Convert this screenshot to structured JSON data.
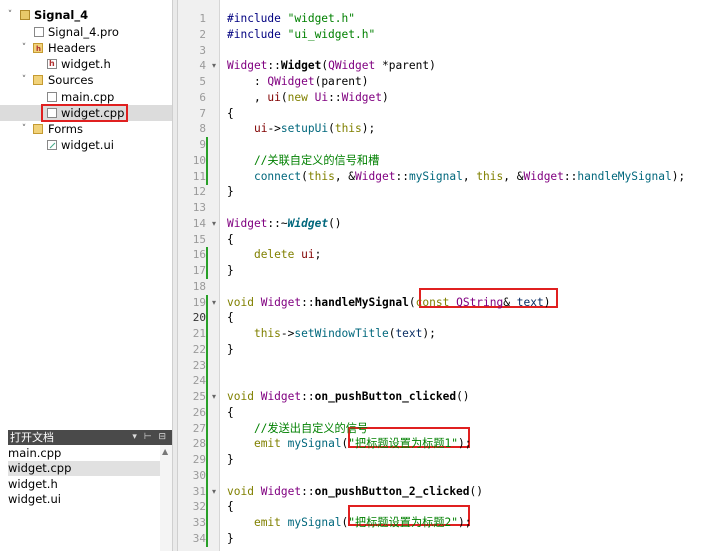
{
  "project_tree": {
    "project": "Signal_4",
    "pro_file": "Signal_4.pro",
    "headers_label": "Headers",
    "header_file": "widget.h",
    "sources_label": "Sources",
    "source_files": [
      "main.cpp",
      "widget.cpp"
    ],
    "forms_label": "Forms",
    "form_file": "widget.ui",
    "selected": "widget.cpp"
  },
  "open_documents": {
    "title": "打开文档",
    "files": [
      "main.cpp",
      "widget.cpp",
      "widget.h",
      "widget.ui"
    ],
    "selected": "widget.cpp"
  },
  "editor": {
    "current_line": 20,
    "lines": [
      {
        "n": "1",
        "t": [
          [
            "#include ",
            "pp"
          ],
          [
            "\"widget.h\"",
            "str"
          ]
        ]
      },
      {
        "n": "2",
        "t": [
          [
            "#include ",
            "pp"
          ],
          [
            "\"ui_widget.h\"",
            "str"
          ]
        ]
      },
      {
        "n": "3",
        "t": []
      },
      {
        "n": "4",
        "t": [
          [
            "Widget",
            "cls"
          ],
          [
            "::",
            "x"
          ],
          [
            "Widget",
            "def"
          ],
          [
            "(",
            "x"
          ],
          [
            "QWidget",
            "cls"
          ],
          [
            " *parent)",
            "x"
          ]
        ]
      },
      {
        "n": "5",
        "t": [
          [
            "    : ",
            "x"
          ],
          [
            "QWidget",
            "cls"
          ],
          [
            "(parent)",
            "x"
          ]
        ]
      },
      {
        "n": "6",
        "t": [
          [
            "    , ",
            "x"
          ],
          [
            "ui",
            "mem"
          ],
          [
            "(",
            "x"
          ],
          [
            "new",
            "kw"
          ],
          [
            " ",
            "x"
          ],
          [
            "Ui",
            "cls"
          ],
          [
            "::",
            "x"
          ],
          [
            "Widget",
            "cls"
          ],
          [
            ")",
            "x"
          ]
        ]
      },
      {
        "n": "7",
        "t": [
          [
            "{",
            "x"
          ]
        ]
      },
      {
        "n": "8",
        "t": [
          [
            "    ",
            "x"
          ],
          [
            "ui",
            "mem"
          ],
          [
            "->",
            "x"
          ],
          [
            "setupUi",
            "fn"
          ],
          [
            "(",
            "x"
          ],
          [
            "this",
            "kw"
          ],
          [
            ");",
            "x"
          ]
        ]
      },
      {
        "n": "9",
        "t": []
      },
      {
        "n": "10",
        "t": [
          [
            "    //关联自定义的信号和槽",
            "cmt"
          ]
        ]
      },
      {
        "n": "11",
        "t": [
          [
            "    ",
            "x"
          ],
          [
            "connect",
            "fn"
          ],
          [
            "(",
            "x"
          ],
          [
            "this",
            "kw"
          ],
          [
            ", &",
            "x"
          ],
          [
            "Widget",
            "cls"
          ],
          [
            "::",
            "x"
          ],
          [
            "mySignal",
            "fn"
          ],
          [
            ", ",
            "x"
          ],
          [
            "this",
            "kw"
          ],
          [
            ", &",
            "x"
          ],
          [
            "Widget",
            "cls"
          ],
          [
            "::",
            "x"
          ],
          [
            "handleMySignal",
            "fn"
          ],
          [
            ");",
            "x"
          ]
        ]
      },
      {
        "n": "12",
        "t": [
          [
            "}",
            "x"
          ]
        ]
      },
      {
        "n": "13",
        "t": []
      },
      {
        "n": "14",
        "t": [
          [
            "Widget",
            "cls"
          ],
          [
            "::~",
            "x"
          ],
          [
            "Widget",
            "defi"
          ],
          [
            "()",
            "x"
          ]
        ]
      },
      {
        "n": "15",
        "t": [
          [
            "{",
            "x"
          ]
        ]
      },
      {
        "n": "16",
        "t": [
          [
            "    ",
            "x"
          ],
          [
            "delete",
            "kw"
          ],
          [
            " ",
            "x"
          ],
          [
            "ui",
            "mem"
          ],
          [
            ";",
            "x"
          ]
        ]
      },
      {
        "n": "17",
        "t": [
          [
            "}",
            "x"
          ]
        ]
      },
      {
        "n": "18",
        "t": []
      },
      {
        "n": "19",
        "t": [
          [
            "void",
            "kw"
          ],
          [
            " ",
            "x"
          ],
          [
            "Widget",
            "cls"
          ],
          [
            "::",
            "x"
          ],
          [
            "handleMySignal",
            "def"
          ],
          [
            "(",
            "x"
          ],
          [
            "const",
            "kw"
          ],
          [
            " ",
            "x"
          ],
          [
            "QString",
            "cls"
          ],
          [
            "& ",
            "x"
          ],
          [
            "text",
            "par"
          ],
          [
            ")",
            "x"
          ]
        ]
      },
      {
        "n": "20",
        "t": [
          [
            "{",
            "x"
          ]
        ]
      },
      {
        "n": "21",
        "t": [
          [
            "    ",
            "x"
          ],
          [
            "this",
            "kw"
          ],
          [
            "->",
            "x"
          ],
          [
            "setWindowTitle",
            "fn"
          ],
          [
            "(",
            "x"
          ],
          [
            "text",
            "par"
          ],
          [
            ");",
            "x"
          ]
        ]
      },
      {
        "n": "22",
        "t": [
          [
            "}",
            "x"
          ]
        ]
      },
      {
        "n": "23",
        "t": []
      },
      {
        "n": "24",
        "t": []
      },
      {
        "n": "25",
        "t": [
          [
            "void",
            "kw"
          ],
          [
            " ",
            "x"
          ],
          [
            "Widget",
            "cls"
          ],
          [
            "::",
            "x"
          ],
          [
            "on_pushButton_clicked",
            "def"
          ],
          [
            "()",
            "x"
          ]
        ]
      },
      {
        "n": "26",
        "t": [
          [
            "{",
            "x"
          ]
        ]
      },
      {
        "n": "27",
        "t": [
          [
            "    //发送出自定义的信号",
            "cmt"
          ]
        ]
      },
      {
        "n": "28",
        "t": [
          [
            "    ",
            "x"
          ],
          [
            "emit",
            "kw"
          ],
          [
            " ",
            "x"
          ],
          [
            "mySignal",
            "fn"
          ],
          [
            "(",
            "x"
          ],
          [
            "\"把标题设置为标题1\"",
            "str"
          ],
          [
            ");",
            "x"
          ]
        ]
      },
      {
        "n": "29",
        "t": [
          [
            "}",
            "x"
          ]
        ]
      },
      {
        "n": "30",
        "t": []
      },
      {
        "n": "31",
        "t": [
          [
            "void",
            "kw"
          ],
          [
            " ",
            "x"
          ],
          [
            "Widget",
            "cls"
          ],
          [
            "::",
            "x"
          ],
          [
            "on_pushButton_2_clicked",
            "def"
          ],
          [
            "()",
            "x"
          ]
        ]
      },
      {
        "n": "32",
        "t": [
          [
            "{",
            "x"
          ]
        ]
      },
      {
        "n": "33",
        "t": [
          [
            "    ",
            "x"
          ],
          [
            "emit",
            "kw"
          ],
          [
            " ",
            "x"
          ],
          [
            "mySignal",
            "fn"
          ],
          [
            "(",
            "x"
          ],
          [
            "\"把标题设置为标题2\"",
            "str"
          ],
          [
            ");",
            "x"
          ]
        ]
      },
      {
        "n": "34",
        "t": [
          [
            "}",
            "x"
          ]
        ]
      }
    ],
    "fold_lines": [
      "4",
      "14",
      "19",
      "25",
      "31"
    ],
    "modified_lines": [
      "9",
      "10",
      "11",
      "16",
      "17",
      "19",
      "20",
      "21",
      "22",
      "23",
      "24",
      "25",
      "26",
      "27",
      "28",
      "29",
      "30",
      "31",
      "32",
      "33",
      "34"
    ]
  }
}
